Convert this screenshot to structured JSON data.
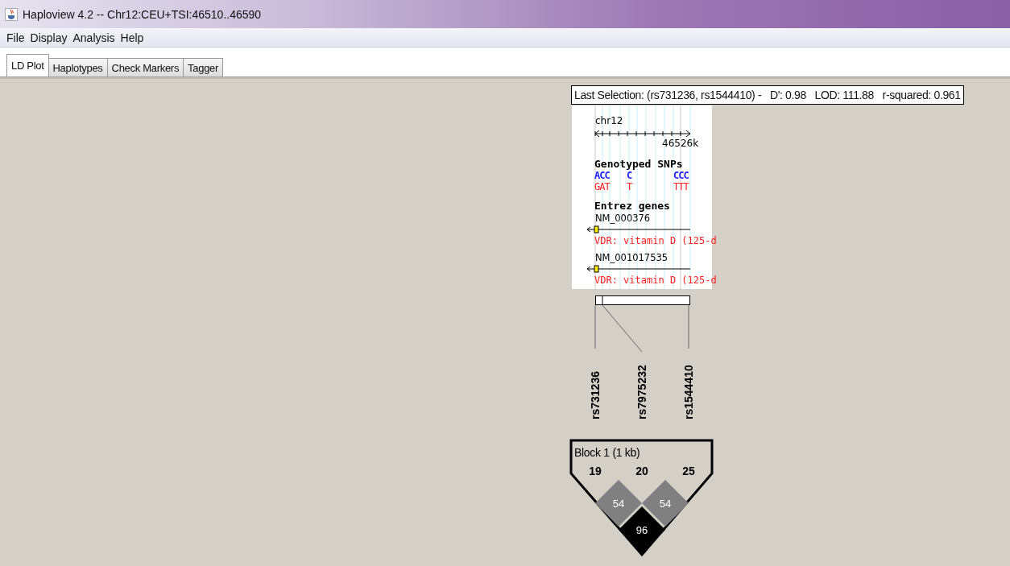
{
  "window": {
    "title": "Haploview 4.2 -- Chr12:CEU+TSI:46510..46590"
  },
  "menu": [
    "File",
    "Display",
    "Analysis",
    "Help"
  ],
  "tabs": [
    {
      "label": "LD Plot",
      "selected": true
    },
    {
      "label": "Haplotypes",
      "selected": false
    },
    {
      "label": "Check Markers",
      "selected": false
    },
    {
      "label": "Tagger",
      "selected": false
    }
  ],
  "selection_info": "Last Selection: (rs731236, rs1544410) -   D': 0.98   LOD: 111.88   r-squared: 0.961",
  "browser": {
    "chromosome": "chr12",
    "scale_label": "46526k",
    "snps_title": "Genotyped SNPs",
    "alleles": [
      {
        "top": "ACC",
        "bottom": "GAT"
      },
      {
        "top": "C",
        "bottom": "T"
      },
      {
        "top": "CCC",
        "bottom": "TTT"
      }
    ],
    "genes_title": "Entrez genes",
    "genes": [
      {
        "id": "NM_000376",
        "label": "VDR: vitamin D (125-d"
      },
      {
        "id": "NM_001017535",
        "label": "VDR: vitamin D (125-d"
      }
    ]
  },
  "markers": [
    {
      "name": "rs731236",
      "number": "19"
    },
    {
      "name": "rs7975232",
      "number": "20"
    },
    {
      "name": "rs1544410",
      "number": "25"
    }
  ],
  "block": {
    "title": "Block 1 (1 kb)"
  },
  "ld_cells": [
    {
      "value": "54",
      "color": "#808080"
    },
    {
      "value": "54",
      "color": "#808080"
    },
    {
      "value": "96",
      "color": "#000000"
    }
  ]
}
